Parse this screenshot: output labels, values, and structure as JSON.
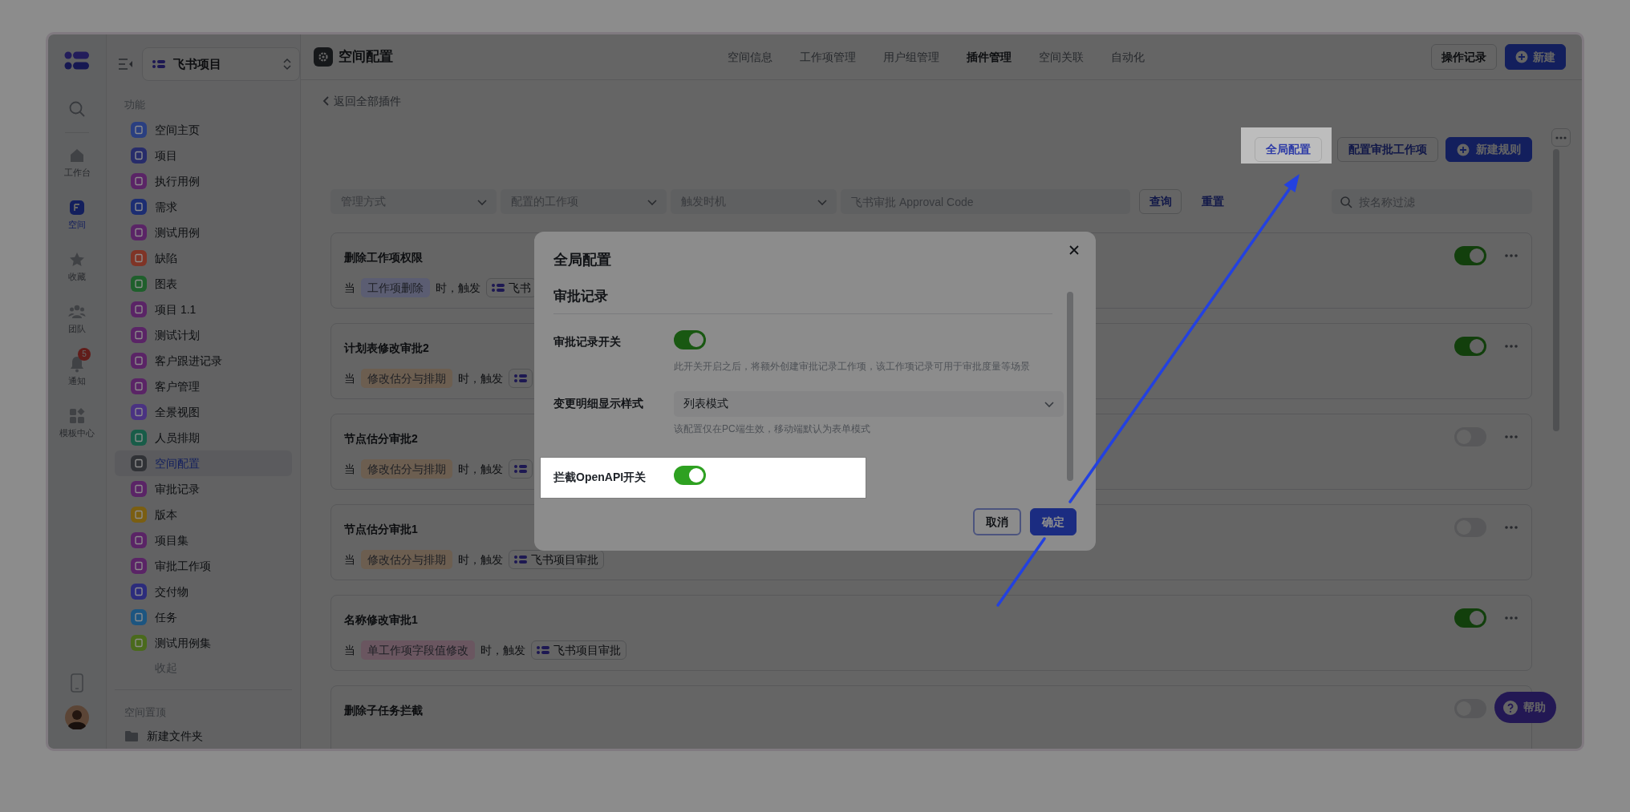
{
  "rail": {
    "items": [
      {
        "label": "工作台",
        "selected": false
      },
      {
        "label": "空间",
        "selected": true
      },
      {
        "label": "收藏",
        "selected": false
      },
      {
        "label": "团队",
        "selected": false
      },
      {
        "label": "通知",
        "selected": false,
        "badge": "5"
      },
      {
        "label": "模板中心",
        "selected": false
      }
    ]
  },
  "sidebar": {
    "project": "飞书项目",
    "section": "功能",
    "items": [
      {
        "label": "空间主页",
        "color": "#2a3f80",
        "selected": false
      },
      {
        "label": "项目",
        "color": "#272c6a",
        "selected": false
      },
      {
        "label": "执行用例",
        "color": "#5a2466",
        "selected": false
      },
      {
        "label": "需求",
        "color": "#1c2d72",
        "selected": false
      },
      {
        "label": "测试用例",
        "color": "#5a2466",
        "selected": false
      },
      {
        "label": "缺陷",
        "color": "#7f3426",
        "selected": false
      },
      {
        "label": "图表",
        "color": "#1f5f2c",
        "selected": false
      },
      {
        "label": "项目 1.1",
        "color": "#5a2466",
        "selected": false
      },
      {
        "label": "测试计划",
        "color": "#5a2466",
        "selected": false
      },
      {
        "label": "客户跟进记录",
        "color": "#5a2466",
        "selected": false
      },
      {
        "label": "客户管理",
        "color": "#5a2466",
        "selected": false
      },
      {
        "label": "全景视图",
        "color": "#4a3282",
        "selected": false
      },
      {
        "label": "人员排期",
        "color": "#185c48",
        "selected": false
      },
      {
        "label": "空间配置",
        "color": "#303236",
        "selected": true
      },
      {
        "label": "审批记录",
        "color": "#5a2466",
        "selected": false
      },
      {
        "label": "版本",
        "color": "#7a5e12",
        "selected": false
      },
      {
        "label": "项目集",
        "color": "#5a2466",
        "selected": false
      },
      {
        "label": "审批工作项",
        "color": "#5a2466",
        "selected": false
      },
      {
        "label": "交付物",
        "color": "#2c2c7c",
        "selected": false
      },
      {
        "label": "任务",
        "color": "#1c5580",
        "selected": false
      },
      {
        "label": "测试用例集",
        "color": "#4a6a1c",
        "selected": false
      }
    ],
    "collapse": "收起",
    "pinned_section": "空间置顶",
    "folders": [
      "新建文件夹"
    ]
  },
  "header": {
    "title": "空间配置",
    "tabs": [
      {
        "label": "空间信息",
        "selected": false
      },
      {
        "label": "工作项管理",
        "selected": false
      },
      {
        "label": "用户组管理",
        "selected": false
      },
      {
        "label": "插件管理",
        "selected": true
      },
      {
        "label": "空间关联",
        "selected": false
      },
      {
        "label": "自动化",
        "selected": false
      }
    ],
    "buttons": [
      {
        "label": "操作记录",
        "kind": "outline"
      },
      {
        "label": "新建",
        "kind": "primary"
      }
    ]
  },
  "back_link": "返回全部插件",
  "actions": [
    {
      "label": "全局配置",
      "kind": "outline",
      "highlighted": true
    },
    {
      "label": "配置审批工作项",
      "kind": "outline",
      "highlighted": false
    },
    {
      "label": "新建规则",
      "kind": "primary",
      "highlighted": false
    }
  ],
  "filters": {
    "selects": [
      {
        "placeholder": "管理方式"
      },
      {
        "placeholder": "配置的工作项"
      },
      {
        "placeholder": "触发时机"
      }
    ],
    "code_input": {
      "placeholder": "飞书审批 Approval Code"
    },
    "query_button": "查询",
    "reset_link": "重置",
    "search": {
      "placeholder": "按名称过滤"
    }
  },
  "rules": [
    {
      "title": "删除工作项权限",
      "prefix": "当",
      "trigger": "工作项删除",
      "color": "#5b5d72",
      "middle": "时，触发",
      "target": "飞书",
      "on": true
    },
    {
      "title": "计划表修改审批2",
      "prefix": "当",
      "trigger": "修改估分与排期",
      "color": "#6c5e50",
      "middle": "时，触发",
      "on": true
    },
    {
      "title": "节点估分审批2",
      "prefix": "当",
      "trigger": "修改估分与排期",
      "color": "#6c5e50",
      "middle": "时，触发",
      "on": false
    },
    {
      "title": "节点估分审批1",
      "prefix": "当",
      "trigger": "修改估分与排期",
      "color": "#6c5e50",
      "middle": "时，触发",
      "target": "飞书项目审批",
      "on": false
    },
    {
      "title": "名称修改审批1",
      "prefix": "当",
      "trigger": "单工作项字段值修改",
      "color": "#6a5660",
      "middle": "时，触发",
      "target": "飞书项目审批",
      "on": true
    },
    {
      "title": "删除子任务拦截",
      "on": false
    }
  ],
  "modal": {
    "title": "全局配置",
    "section": "审批记录",
    "rows": [
      {
        "kind": "switch",
        "label": "审批记录开关",
        "on": true,
        "hint": "此开关开启之后，将额外创建审批记录工作项，该工作项记录可用于审批度量等场景",
        "highlighted": false
      },
      {
        "kind": "select",
        "label": "变更明细显示样式",
        "value": "列表模式",
        "hint": "该配置仅在PC端生效，移动端默认为表单模式",
        "highlighted": false
      },
      {
        "kind": "switch",
        "label": "拦截OpenAPI开关",
        "on": true,
        "highlighted": true
      }
    ],
    "buttons": [
      {
        "label": "取消",
        "kind": "outline",
        "focused": true
      },
      {
        "label": "确定",
        "kind": "primary",
        "focused": false
      }
    ]
  },
  "help_button": "帮助"
}
